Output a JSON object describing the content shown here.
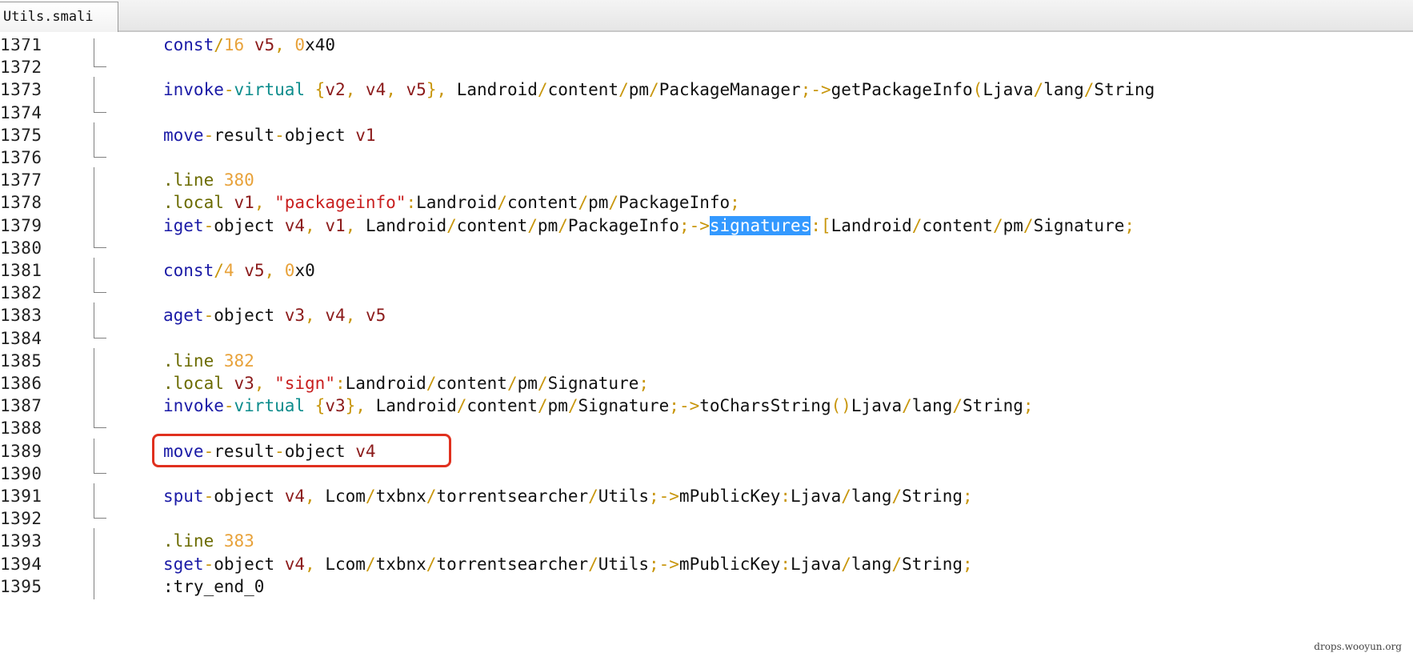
{
  "tab": {
    "label": "Utils.smali"
  },
  "colors": {
    "kw": "#1a1aa6",
    "kw2": "#0c8c8c",
    "reg": "#8b1a1a",
    "op": "#c8960c",
    "str": "#c81e1e",
    "sym": "#111111",
    "num": "#e8a23a",
    "directive": "#6b6b00"
  },
  "lines": [
    {
      "n": "1371",
      "fold": "v",
      "tokens": [
        {
          "t": "const",
          "c": "kw"
        },
        {
          "t": "/",
          "c": "op"
        },
        {
          "t": "16",
          "c": "num"
        },
        {
          "t": " ",
          "c": "sym"
        },
        {
          "t": "v5",
          "c": "reg"
        },
        {
          "t": ", ",
          "c": "op"
        },
        {
          "t": "0",
          "c": "num"
        },
        {
          "t": "x40",
          "c": "sym"
        }
      ]
    },
    {
      "n": "1372",
      "fold": "h",
      "tokens": []
    },
    {
      "n": "1373",
      "fold": "v",
      "tokens": [
        {
          "t": "invoke",
          "c": "kw"
        },
        {
          "t": "-",
          "c": "op"
        },
        {
          "t": "virtual",
          "c": "kw2"
        },
        {
          "t": " {",
          "c": "op"
        },
        {
          "t": "v2",
          "c": "reg"
        },
        {
          "t": ", ",
          "c": "op"
        },
        {
          "t": "v4",
          "c": "reg"
        },
        {
          "t": ", ",
          "c": "op"
        },
        {
          "t": "v5",
          "c": "reg"
        },
        {
          "t": "}, ",
          "c": "op"
        },
        {
          "t": "Landroid",
          "c": "sym"
        },
        {
          "t": "/",
          "c": "op"
        },
        {
          "t": "content",
          "c": "sym"
        },
        {
          "t": "/",
          "c": "op"
        },
        {
          "t": "pm",
          "c": "sym"
        },
        {
          "t": "/",
          "c": "op"
        },
        {
          "t": "PackageManager",
          "c": "sym"
        },
        {
          "t": ";->",
          "c": "op"
        },
        {
          "t": "getPackageInfo",
          "c": "sym"
        },
        {
          "t": "(",
          "c": "op"
        },
        {
          "t": "Ljava",
          "c": "sym"
        },
        {
          "t": "/",
          "c": "op"
        },
        {
          "t": "lang",
          "c": "sym"
        },
        {
          "t": "/",
          "c": "op"
        },
        {
          "t": "String",
          "c": "sym"
        }
      ]
    },
    {
      "n": "1374",
      "fold": "h",
      "tokens": []
    },
    {
      "n": "1375",
      "fold": "v",
      "tokens": [
        {
          "t": "move",
          "c": "kw"
        },
        {
          "t": "-",
          "c": "op"
        },
        {
          "t": "result",
          "c": "sym"
        },
        {
          "t": "-",
          "c": "op"
        },
        {
          "t": "object",
          "c": "sym"
        },
        {
          "t": " ",
          "c": "sym"
        },
        {
          "t": "v1",
          "c": "reg"
        }
      ]
    },
    {
      "n": "1376",
      "fold": "h",
      "tokens": []
    },
    {
      "n": "1377",
      "fold": "v",
      "tokens": [
        {
          "t": ".line",
          "c": "directive"
        },
        {
          "t": " ",
          "c": "sym"
        },
        {
          "t": "380",
          "c": "num"
        }
      ]
    },
    {
      "n": "1378",
      "fold": "v",
      "tokens": [
        {
          "t": ".local",
          "c": "directive"
        },
        {
          "t": " ",
          "c": "sym"
        },
        {
          "t": "v1",
          "c": "reg"
        },
        {
          "t": ", ",
          "c": "op"
        },
        {
          "t": "\"packageinfo\"",
          "c": "str"
        },
        {
          "t": ":",
          "c": "op"
        },
        {
          "t": "Landroid",
          "c": "sym"
        },
        {
          "t": "/",
          "c": "op"
        },
        {
          "t": "content",
          "c": "sym"
        },
        {
          "t": "/",
          "c": "op"
        },
        {
          "t": "pm",
          "c": "sym"
        },
        {
          "t": "/",
          "c": "op"
        },
        {
          "t": "PackageInfo",
          "c": "sym"
        },
        {
          "t": ";",
          "c": "op"
        }
      ]
    },
    {
      "n": "1379",
      "fold": "v",
      "tokens": [
        {
          "t": "iget",
          "c": "kw"
        },
        {
          "t": "-",
          "c": "op"
        },
        {
          "t": "object",
          "c": "sym"
        },
        {
          "t": " ",
          "c": "sym"
        },
        {
          "t": "v4",
          "c": "reg"
        },
        {
          "t": ", ",
          "c": "op"
        },
        {
          "t": "v1",
          "c": "reg"
        },
        {
          "t": ", ",
          "c": "op"
        },
        {
          "t": "Landroid",
          "c": "sym"
        },
        {
          "t": "/",
          "c": "op"
        },
        {
          "t": "content",
          "c": "sym"
        },
        {
          "t": "/",
          "c": "op"
        },
        {
          "t": "pm",
          "c": "sym"
        },
        {
          "t": "/",
          "c": "op"
        },
        {
          "t": "PackageInfo",
          "c": "sym"
        },
        {
          "t": ";->",
          "c": "op"
        },
        {
          "t": "signatures",
          "c": "sel"
        },
        {
          "t": ":[",
          "c": "op"
        },
        {
          "t": "Landroid",
          "c": "sym"
        },
        {
          "t": "/",
          "c": "op"
        },
        {
          "t": "content",
          "c": "sym"
        },
        {
          "t": "/",
          "c": "op"
        },
        {
          "t": "pm",
          "c": "sym"
        },
        {
          "t": "/",
          "c": "op"
        },
        {
          "t": "Signature",
          "c": "sym"
        },
        {
          "t": ";",
          "c": "op"
        }
      ]
    },
    {
      "n": "1380",
      "fold": "h",
      "tokens": []
    },
    {
      "n": "1381",
      "fold": "v",
      "tokens": [
        {
          "t": "const",
          "c": "kw"
        },
        {
          "t": "/",
          "c": "op"
        },
        {
          "t": "4",
          "c": "num"
        },
        {
          "t": " ",
          "c": "sym"
        },
        {
          "t": "v5",
          "c": "reg"
        },
        {
          "t": ", ",
          "c": "op"
        },
        {
          "t": "0",
          "c": "num"
        },
        {
          "t": "x0",
          "c": "sym"
        }
      ]
    },
    {
      "n": "1382",
      "fold": "h",
      "tokens": []
    },
    {
      "n": "1383",
      "fold": "v",
      "tokens": [
        {
          "t": "aget",
          "c": "kw"
        },
        {
          "t": "-",
          "c": "op"
        },
        {
          "t": "object",
          "c": "sym"
        },
        {
          "t": " ",
          "c": "sym"
        },
        {
          "t": "v3",
          "c": "reg"
        },
        {
          "t": ", ",
          "c": "op"
        },
        {
          "t": "v4",
          "c": "reg"
        },
        {
          "t": ", ",
          "c": "op"
        },
        {
          "t": "v5",
          "c": "reg"
        }
      ]
    },
    {
      "n": "1384",
      "fold": "h",
      "tokens": []
    },
    {
      "n": "1385",
      "fold": "v",
      "tokens": [
        {
          "t": ".line",
          "c": "directive"
        },
        {
          "t": " ",
          "c": "sym"
        },
        {
          "t": "382",
          "c": "num"
        }
      ]
    },
    {
      "n": "1386",
      "fold": "v",
      "tokens": [
        {
          "t": ".local",
          "c": "directive"
        },
        {
          "t": " ",
          "c": "sym"
        },
        {
          "t": "v3",
          "c": "reg"
        },
        {
          "t": ", ",
          "c": "op"
        },
        {
          "t": "\"sign\"",
          "c": "str"
        },
        {
          "t": ":",
          "c": "op"
        },
        {
          "t": "Landroid",
          "c": "sym"
        },
        {
          "t": "/",
          "c": "op"
        },
        {
          "t": "content",
          "c": "sym"
        },
        {
          "t": "/",
          "c": "op"
        },
        {
          "t": "pm",
          "c": "sym"
        },
        {
          "t": "/",
          "c": "op"
        },
        {
          "t": "Signature",
          "c": "sym"
        },
        {
          "t": ";",
          "c": "op"
        }
      ]
    },
    {
      "n": "1387",
      "fold": "v",
      "tokens": [
        {
          "t": "invoke",
          "c": "kw"
        },
        {
          "t": "-",
          "c": "op"
        },
        {
          "t": "virtual",
          "c": "kw2"
        },
        {
          "t": " {",
          "c": "op"
        },
        {
          "t": "v3",
          "c": "reg"
        },
        {
          "t": "}, ",
          "c": "op"
        },
        {
          "t": "Landroid",
          "c": "sym"
        },
        {
          "t": "/",
          "c": "op"
        },
        {
          "t": "content",
          "c": "sym"
        },
        {
          "t": "/",
          "c": "op"
        },
        {
          "t": "pm",
          "c": "sym"
        },
        {
          "t": "/",
          "c": "op"
        },
        {
          "t": "Signature",
          "c": "sym"
        },
        {
          "t": ";->",
          "c": "op"
        },
        {
          "t": "toCharsString",
          "c": "sym"
        },
        {
          "t": "()",
          "c": "op"
        },
        {
          "t": "Ljava",
          "c": "sym"
        },
        {
          "t": "/",
          "c": "op"
        },
        {
          "t": "lang",
          "c": "sym"
        },
        {
          "t": "/",
          "c": "op"
        },
        {
          "t": "String",
          "c": "sym"
        },
        {
          "t": ";",
          "c": "op"
        }
      ]
    },
    {
      "n": "1388",
      "fold": "h",
      "tokens": []
    },
    {
      "n": "1389",
      "fold": "v",
      "boxed": true,
      "tokens": [
        {
          "t": "move",
          "c": "kw"
        },
        {
          "t": "-",
          "c": "op"
        },
        {
          "t": "result",
          "c": "sym"
        },
        {
          "t": "-",
          "c": "op"
        },
        {
          "t": "object",
          "c": "sym"
        },
        {
          "t": " ",
          "c": "sym"
        },
        {
          "t": "v4",
          "c": "reg"
        }
      ]
    },
    {
      "n": "1390",
      "fold": "h",
      "tokens": []
    },
    {
      "n": "1391",
      "fold": "v",
      "tokens": [
        {
          "t": "sput",
          "c": "kw"
        },
        {
          "t": "-",
          "c": "op"
        },
        {
          "t": "object",
          "c": "sym"
        },
        {
          "t": " ",
          "c": "sym"
        },
        {
          "t": "v4",
          "c": "reg"
        },
        {
          "t": ", ",
          "c": "op"
        },
        {
          "t": "Lcom",
          "c": "sym"
        },
        {
          "t": "/",
          "c": "op"
        },
        {
          "t": "txbnx",
          "c": "sym"
        },
        {
          "t": "/",
          "c": "op"
        },
        {
          "t": "torrentsearcher",
          "c": "sym"
        },
        {
          "t": "/",
          "c": "op"
        },
        {
          "t": "Utils",
          "c": "sym"
        },
        {
          "t": ";->",
          "c": "op"
        },
        {
          "t": "mPublicKey",
          "c": "sym"
        },
        {
          "t": ":",
          "c": "op"
        },
        {
          "t": "Ljava",
          "c": "sym"
        },
        {
          "t": "/",
          "c": "op"
        },
        {
          "t": "lang",
          "c": "sym"
        },
        {
          "t": "/",
          "c": "op"
        },
        {
          "t": "String",
          "c": "sym"
        },
        {
          "t": ";",
          "c": "op"
        }
      ]
    },
    {
      "n": "1392",
      "fold": "h",
      "tokens": []
    },
    {
      "n": "1393",
      "fold": "v",
      "tokens": [
        {
          "t": ".line",
          "c": "directive"
        },
        {
          "t": " ",
          "c": "sym"
        },
        {
          "t": "383",
          "c": "num"
        }
      ]
    },
    {
      "n": "1394",
      "fold": "v",
      "tokens": [
        {
          "t": "sget",
          "c": "kw"
        },
        {
          "t": "-",
          "c": "op"
        },
        {
          "t": "object",
          "c": "sym"
        },
        {
          "t": " ",
          "c": "sym"
        },
        {
          "t": "v4",
          "c": "reg"
        },
        {
          "t": ", ",
          "c": "op"
        },
        {
          "t": "Lcom",
          "c": "sym"
        },
        {
          "t": "/",
          "c": "op"
        },
        {
          "t": "txbnx",
          "c": "sym"
        },
        {
          "t": "/",
          "c": "op"
        },
        {
          "t": "torrentsearcher",
          "c": "sym"
        },
        {
          "t": "/",
          "c": "op"
        },
        {
          "t": "Utils",
          "c": "sym"
        },
        {
          "t": ";->",
          "c": "op"
        },
        {
          "t": "mPublicKey",
          "c": "sym"
        },
        {
          "t": ":",
          "c": "op"
        },
        {
          "t": "Ljava",
          "c": "sym"
        },
        {
          "t": "/",
          "c": "op"
        },
        {
          "t": "lang",
          "c": "sym"
        },
        {
          "t": "/",
          "c": "op"
        },
        {
          "t": "String",
          "c": "sym"
        },
        {
          "t": ";",
          "c": "op"
        }
      ]
    },
    {
      "n": "1395",
      "fold": "v",
      "tokens": [
        {
          "t": ":try_end_0",
          "c": "sym"
        }
      ]
    }
  ],
  "watermark": "drops.wooyun.org"
}
